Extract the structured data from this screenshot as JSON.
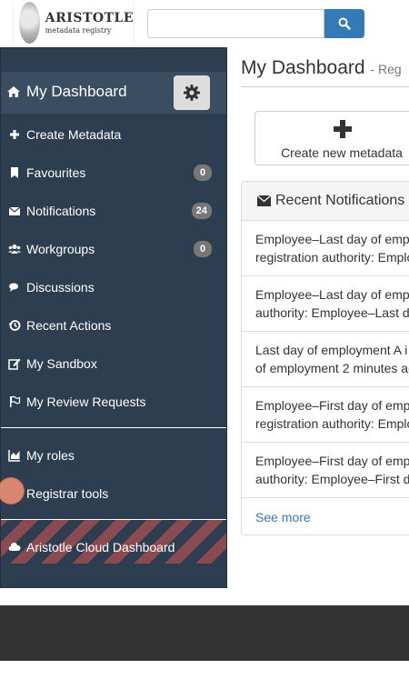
{
  "header": {
    "logo": {
      "title": "ARISTOTLE",
      "subtitle": "metadata registry"
    },
    "search": {
      "placeholder": "",
      "icon": "search-icon"
    }
  },
  "sidebar": {
    "heading": "My Dashboard",
    "items": [
      {
        "label": "Create Metadata",
        "icon": "plus-icon"
      },
      {
        "label": "Favourites",
        "icon": "bookmark-icon",
        "badge": "0"
      },
      {
        "label": "Notifications",
        "icon": "envelope-icon",
        "badge": "24"
      },
      {
        "label": "Workgroups",
        "icon": "users-icon",
        "badge": "0"
      },
      {
        "label": "Discussions",
        "icon": "comments-icon"
      },
      {
        "label": "Recent Actions",
        "icon": "history-icon"
      },
      {
        "label": "My Sandbox",
        "icon": "edit-icon"
      },
      {
        "label": "My Review Requests",
        "icon": "flag-icon"
      },
      {
        "label": "My roles",
        "icon": "chart-icon"
      },
      {
        "label": "Registrar tools",
        "icon": "bank-icon"
      },
      {
        "label": "Aristotle Cloud Dashboard",
        "icon": "cloud-icon"
      }
    ]
  },
  "main": {
    "title": "My Dashboard",
    "subtitle": "- Reg",
    "create_button": "Create new metadata",
    "panel": {
      "title": "Recent Notifications",
      "items": [
        "Employee–Last day of emp\nregistration authority: Emplo",
        "Employee–Last day of emp\nauthority: Employee–Last d",
        "Last day of employment A i\nof employment 2 minutes ag",
        "Employee–First day of emp\nregistration authority: Emplo",
        "Employee–First day of emp\nauthority: Employee–First d"
      ],
      "footer_link": "See more"
    }
  },
  "colors": {
    "sidebar_bg": "#2d3e50",
    "primary": "#337ab7",
    "badge": "#777777",
    "footer": "#333333"
  }
}
